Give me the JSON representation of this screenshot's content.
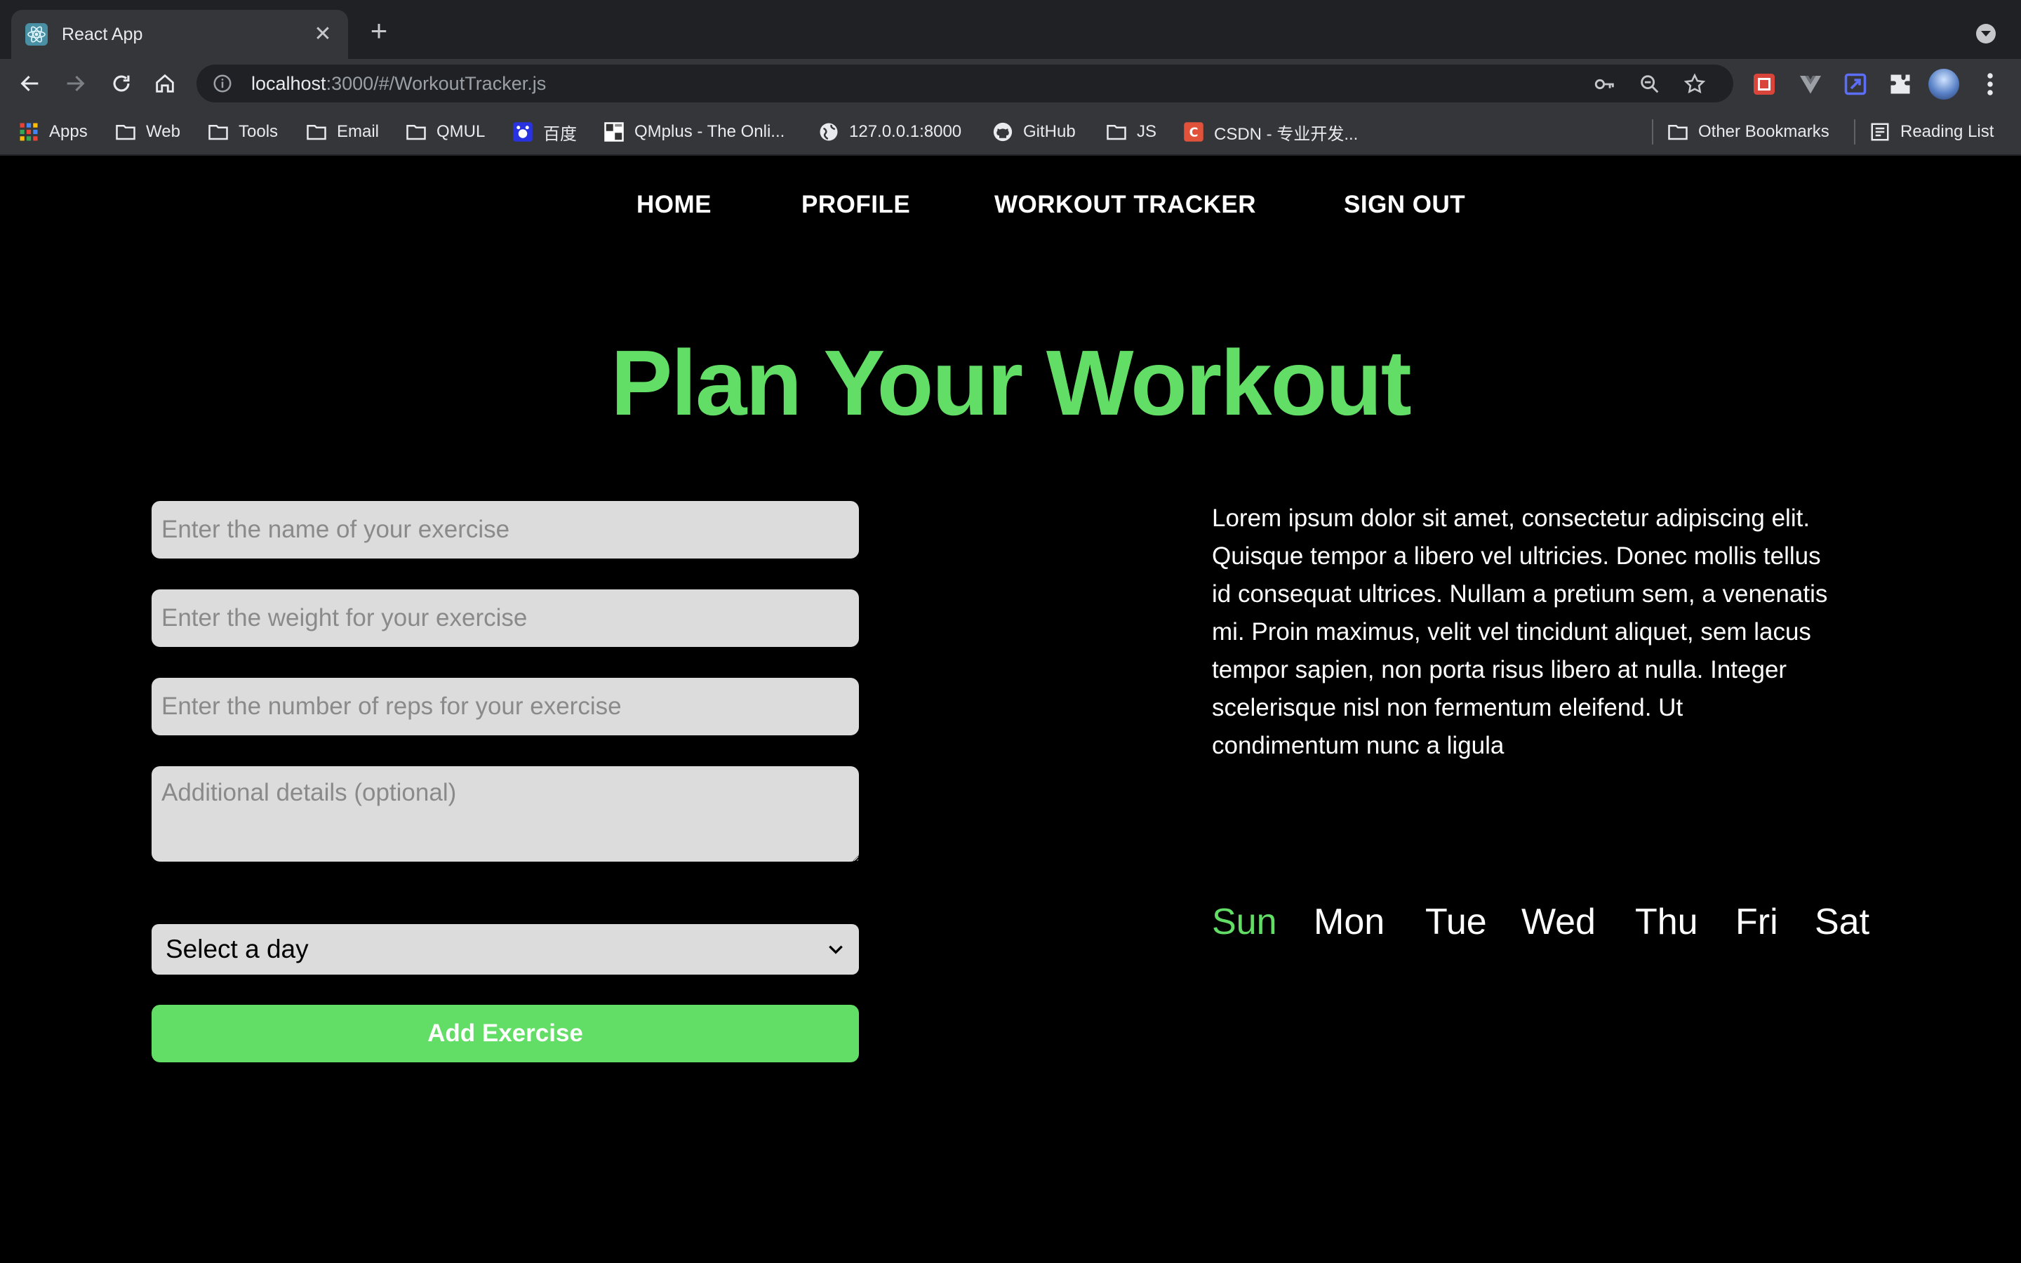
{
  "browser": {
    "tab_title": "React App",
    "url_host": "localhost",
    "url_path": ":3000/#/WorkoutTracker.js",
    "bookmarks": [
      {
        "label": "Apps",
        "icon": "apps-grid-icon"
      },
      {
        "label": "Web",
        "icon": "folder-icon"
      },
      {
        "label": "Tools",
        "icon": "folder-icon"
      },
      {
        "label": "Email",
        "icon": "folder-icon"
      },
      {
        "label": "QMUL",
        "icon": "folder-icon"
      },
      {
        "label": "百度",
        "icon": "baidu-icon"
      },
      {
        "label": "QMplus - The Onli...",
        "icon": "qmplus-icon"
      },
      {
        "label": "127.0.0.1:8000",
        "icon": "globe-icon"
      },
      {
        "label": "GitHub",
        "icon": "github-icon"
      },
      {
        "label": "JS",
        "icon": "folder-icon"
      },
      {
        "label": "CSDN - 专业开发...",
        "icon": "csdn-icon"
      },
      {
        "label": "Other Bookmarks",
        "icon": "folder-icon"
      },
      {
        "label": "Reading List",
        "icon": "reading-list-icon"
      }
    ]
  },
  "nav": {
    "home": "HOME",
    "profile": "PROFILE",
    "workout_tracker": "WORKOUT TRACKER",
    "sign_out": "SIGN OUT"
  },
  "hero_title": "Plan Your Workout",
  "form": {
    "exercise_name_placeholder": "Enter the name of your exercise",
    "weight_placeholder": "Enter the weight for your exercise",
    "reps_placeholder": "Enter the number of reps for your exercise",
    "details_placeholder": "Additional details (optional)",
    "day_select_value": "Select a day",
    "submit_label": "Add Exercise"
  },
  "description": "Lorem ipsum dolor sit amet, consectetur adipiscing elit. Quisque tempor a libero vel ultricies. Donec mollis tellus id consequat ultrices. Nullam a pretium sem, a venenatis mi. Proin maximus, velit vel tincidunt aliquet, sem lacus tempor sapien, non porta risus libero at nulla. Integer scelerisque nisl non fermentum eleifend. Ut condimentum nunc a ligula",
  "days": {
    "sun": "Sun",
    "mon": "Mon",
    "tue": "Tue",
    "wed": "Wed",
    "thu": "Thu",
    "fri": "Fri",
    "sat": "Sat",
    "active": "Sun"
  },
  "colors": {
    "accent_green": "#62dd65",
    "page_background": "#000000",
    "input_background": "#dcdcdc"
  }
}
